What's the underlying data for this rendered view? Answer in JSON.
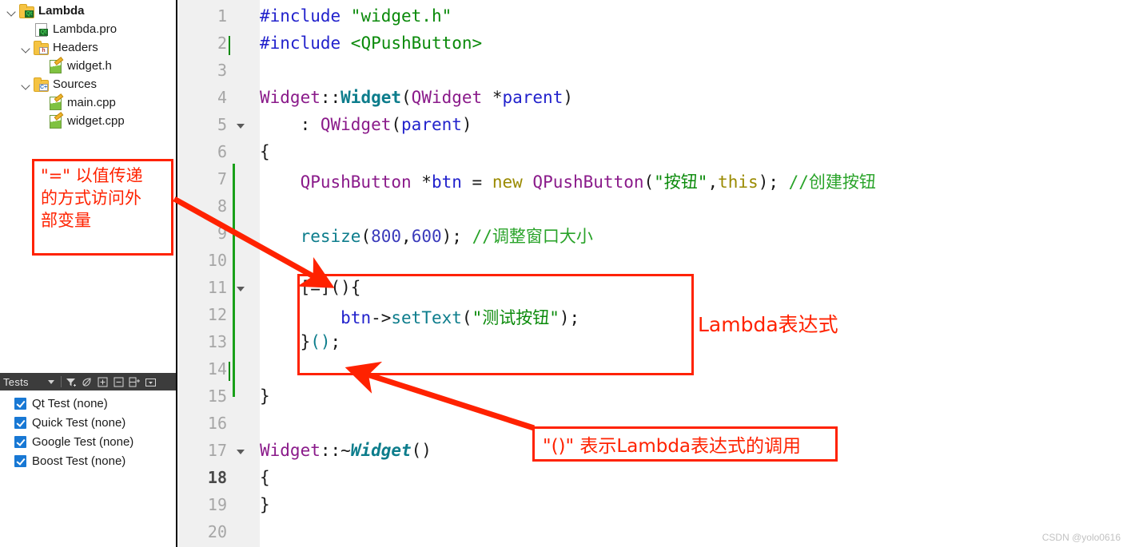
{
  "project_tree": {
    "items": [
      {
        "label": "Lambda",
        "icon": "qt-project-folder-icon",
        "indent": 0,
        "expanded": true,
        "bold": true,
        "kind": "folder-qt"
      },
      {
        "label": "Lambda.pro",
        "icon": "qt-pro-file-icon",
        "indent": 1,
        "expanded": null,
        "bold": false,
        "kind": "file-pro"
      },
      {
        "label": "Headers",
        "icon": "headers-folder-icon",
        "indent": 1,
        "expanded": true,
        "bold": false,
        "kind": "folder-h"
      },
      {
        "label": "widget.h",
        "icon": "cpp-file-icon",
        "indent": 2,
        "expanded": null,
        "bold": false,
        "kind": "file-cpp"
      },
      {
        "label": "Sources",
        "icon": "sources-folder-icon",
        "indent": 1,
        "expanded": true,
        "bold": false,
        "kind": "folder-cpp"
      },
      {
        "label": "main.cpp",
        "icon": "cpp-file-icon",
        "indent": 2,
        "expanded": null,
        "bold": false,
        "kind": "file-cpp"
      },
      {
        "label": "widget.cpp",
        "icon": "cpp-file-icon",
        "indent": 2,
        "expanded": null,
        "bold": false,
        "kind": "file-cpp"
      }
    ]
  },
  "tests_panel": {
    "title": "Tests",
    "toolbar_icons": [
      "chevron-down-icon",
      "filter-icon",
      "leaf-icon",
      "expand-all-icon",
      "collapse-all-icon",
      "split-pane-icon",
      "options-dropdown-icon"
    ],
    "items": [
      {
        "label": "Qt Test (none)",
        "checked": true
      },
      {
        "label": "Quick Test (none)",
        "checked": true
      },
      {
        "label": "Google Test (none)",
        "checked": true
      },
      {
        "label": "Boost Test (none)",
        "checked": true
      }
    ]
  },
  "editor": {
    "current_line": 18,
    "line_numbers": [
      "1",
      "2",
      "3",
      "4",
      "5",
      "6",
      "7",
      "8",
      "9",
      "10",
      "11",
      "12",
      "13",
      "14",
      "15",
      "16",
      "17",
      "18",
      "19",
      "20"
    ],
    "fold_markers": [
      5,
      11,
      17
    ],
    "change_bar_color": "#19a019",
    "lines": [
      {
        "n": 1,
        "tokens": [
          {
            "t": "#include ",
            "c": "t-pre"
          },
          {
            "t": "\"widget.h\"",
            "c": "t-str"
          }
        ]
      },
      {
        "n": 2,
        "tokens": [
          {
            "t": "#include ",
            "c": "t-pre"
          },
          {
            "t": "<QPushButton>",
            "c": "t-str"
          }
        ]
      },
      {
        "n": 3,
        "tokens": []
      },
      {
        "n": 4,
        "tokens": [
          {
            "t": "Widget",
            "c": "t-cls"
          },
          {
            "t": "::",
            "c": "t-pun"
          },
          {
            "t": "Widget",
            "c": "t-fn"
          },
          {
            "t": "(",
            "c": "t-pun"
          },
          {
            "t": "QWidget",
            "c": "t-cls"
          },
          {
            "t": " *",
            "c": "t-pun"
          },
          {
            "t": "parent",
            "c": "t-var"
          },
          {
            "t": ")",
            "c": "t-pun"
          }
        ]
      },
      {
        "n": 5,
        "tokens": [
          {
            "t": "    : ",
            "c": "t-pun"
          },
          {
            "t": "QWidget",
            "c": "t-cls"
          },
          {
            "t": "(",
            "c": "t-pun"
          },
          {
            "t": "parent",
            "c": "t-var"
          },
          {
            "t": ")",
            "c": "t-pun"
          }
        ]
      },
      {
        "n": 6,
        "tokens": [
          {
            "t": "{",
            "c": "t-pun"
          }
        ]
      },
      {
        "n": 7,
        "tokens": [
          {
            "t": "    ",
            "c": "t-pun"
          },
          {
            "t": "QPushButton",
            "c": "t-cls"
          },
          {
            "t": " *",
            "c": "t-pun"
          },
          {
            "t": "btn",
            "c": "t-var"
          },
          {
            "t": " = ",
            "c": "t-pun"
          },
          {
            "t": "new",
            "c": "t-kw"
          },
          {
            "t": " ",
            "c": "t-pun"
          },
          {
            "t": "QPushButton",
            "c": "t-cls"
          },
          {
            "t": "(",
            "c": "t-pun"
          },
          {
            "t": "\"按钮\"",
            "c": "t-str"
          },
          {
            "t": ",",
            "c": "t-pun"
          },
          {
            "t": "this",
            "c": "t-kw"
          },
          {
            "t": "); ",
            "c": "t-pun"
          },
          {
            "t": "//创建按钮",
            "c": "t-cmt"
          }
        ]
      },
      {
        "n": 8,
        "tokens": []
      },
      {
        "n": 9,
        "tokens": [
          {
            "t": "    ",
            "c": "t-pun"
          },
          {
            "t": "resize",
            "c": "t-fn2"
          },
          {
            "t": "(",
            "c": "t-pun"
          },
          {
            "t": "800",
            "c": "t-num"
          },
          {
            "t": ",",
            "c": "t-pun"
          },
          {
            "t": "600",
            "c": "t-num"
          },
          {
            "t": "); ",
            "c": "t-pun"
          },
          {
            "t": "//调整窗口大小",
            "c": "t-cmt"
          }
        ]
      },
      {
        "n": 10,
        "tokens": []
      },
      {
        "n": 11,
        "tokens": [
          {
            "t": "    [=](){",
            "c": "t-pun"
          }
        ]
      },
      {
        "n": 12,
        "tokens": [
          {
            "t": "        ",
            "c": "t-pun"
          },
          {
            "t": "btn",
            "c": "t-var"
          },
          {
            "t": "->",
            "c": "t-pun"
          },
          {
            "t": "setText",
            "c": "t-fn2"
          },
          {
            "t": "(",
            "c": "t-pun"
          },
          {
            "t": "\"测试按钮\"",
            "c": "t-str"
          },
          {
            "t": ");",
            "c": "t-pun"
          }
        ]
      },
      {
        "n": 13,
        "tokens": [
          {
            "t": "    }",
            "c": "t-pun"
          },
          {
            "t": "()",
            "c": "t-fn2"
          },
          {
            "t": ";",
            "c": "t-pun"
          }
        ]
      },
      {
        "n": 14,
        "tokens": []
      },
      {
        "n": 15,
        "tokens": [
          {
            "t": "}",
            "c": "t-pun"
          }
        ]
      },
      {
        "n": 16,
        "tokens": []
      },
      {
        "n": 17,
        "tokens": [
          {
            "t": "Widget",
            "c": "t-cls"
          },
          {
            "t": "::~",
            "c": "t-pun"
          },
          {
            "t": "Widget",
            "c": "t-fn t-ital"
          },
          {
            "t": "()",
            "c": "t-pun"
          }
        ]
      },
      {
        "n": 18,
        "tokens": [
          {
            "t": "{",
            "c": "t-pun"
          }
        ]
      },
      {
        "n": 19,
        "tokens": [
          {
            "t": "}",
            "c": "t-pun"
          }
        ]
      },
      {
        "n": 20,
        "tokens": []
      }
    ]
  },
  "annotations": {
    "color": "#ff2200",
    "left_note_lines": [
      "\"=\" 以值传递",
      "的方式访问外",
      "部变量"
    ],
    "lambda_label": "Lambda表达式",
    "call_note": "\"()\" 表示Lambda表达式的调用"
  },
  "watermark": "CSDN @yolo0616"
}
